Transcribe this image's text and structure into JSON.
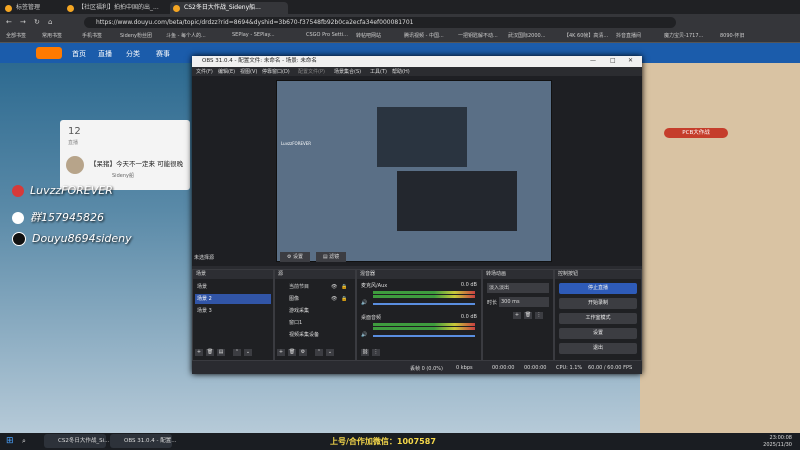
{
  "browser": {
    "tabs": [
      {
        "label": "标签管理"
      },
      {
        "label": "【社区福利】拍拍中国的出_...",
        "note": ""
      },
      {
        "label": "CS2冬日大作战_Sideny船..."
      },
      {
        "label": "CS2冬日大作战_Sideny船..."
      }
    ],
    "url": "https://www.douyu.com/beta/topic/drdzz?rid=8694&dyshid=3b670-f37548fb92b0ca2ecfa34ef000081701",
    "bookmarks": [
      "全部书签",
      "常用书签",
      "手机书签",
      "Sideny粉丝团",
      "斗鱼 - 每个人的...",
      "SEPlay - SEPlay...",
      "CSGO Pro Setti...",
      "转帖吧网站",
      "腾讯视频 - 中国...",
      "一把钥匙解不动...",
      "武汉国际2000...",
      "【4K 60帧】高清...",
      "抖音直播间",
      "魔力宝贝-1717...",
      "8090-怀旧"
    ]
  },
  "site": {
    "nav": [
      "首页",
      "直播",
      "分类",
      "赛事"
    ],
    "card_count": "12",
    "card_label": "直播",
    "topic_title": "【呆猪】今天不一定来 可能很晚",
    "streamer": "Sideny船",
    "right_badge": "PCB大作战"
  },
  "overlay": {
    "lines": [
      {
        "icon": "netease-icon",
        "text": "LuvzzFOREVER"
      },
      {
        "icon": "snowman-icon",
        "text": "群157945826"
      },
      {
        "icon": "tiktok-icon",
        "text": "Douyu8694sideny"
      }
    ]
  },
  "obs": {
    "title": "OBS 31.0.4 - 配置文件: 未命名 - 场景: 未命名",
    "menu": [
      "文件(F)",
      "编辑(E)",
      "视图(V)",
      "停靠窗口(D)",
      "配置文件(P)",
      "场景集合(S)",
      "工具(T)",
      "帮助(H)"
    ],
    "source_bar": {
      "label": "未选择源",
      "settings": "设置",
      "filter": "滤镜"
    },
    "docks": {
      "scenes": {
        "title": "场景",
        "items": [
          "场景",
          "场景 2",
          "场景 3"
        ],
        "selected": 1
      },
      "sources": {
        "title": "源",
        "items": [
          "当前节目",
          "图像",
          "游戏采集",
          "窗口1",
          "视频采集设备"
        ]
      },
      "mixer": {
        "title": "混音器",
        "channels": [
          {
            "name": "麦克风/Aux",
            "db": "0.0 dB"
          },
          {
            "name": "桌面音频",
            "db": "0.0 dB"
          }
        ]
      },
      "transitions": {
        "title": "转场动画",
        "type": "淡入淡出",
        "duration_label": "时长",
        "duration": "300 ms"
      },
      "controls": {
        "title": "控制按钮",
        "buttons": [
          "停止直播",
          "开始录制",
          "工作室模式",
          "设置",
          "退出"
        ]
      }
    },
    "status": {
      "frames": "丢帧 0 (0.0%)",
      "kbps": "0 kbps",
      "time1": "00:00:00",
      "time2": "00:00:00",
      "cpu": "CPU: 1.1%",
      "fps": "60.00 / 60.00 FPS"
    }
  },
  "banner": {
    "text": "上号/合作加微信：1007587"
  },
  "taskbar": {
    "items": [
      "CS2冬日大作战_Si...",
      "OBS 31.0.4 - 配置..."
    ],
    "time": "23:00:08",
    "date": "2025/11/30"
  },
  "colors": {
    "accent": "#2e5bb8",
    "site_header": "#1b5cab",
    "overlay_text": "#ffffff",
    "banner": "#f5d74a"
  }
}
